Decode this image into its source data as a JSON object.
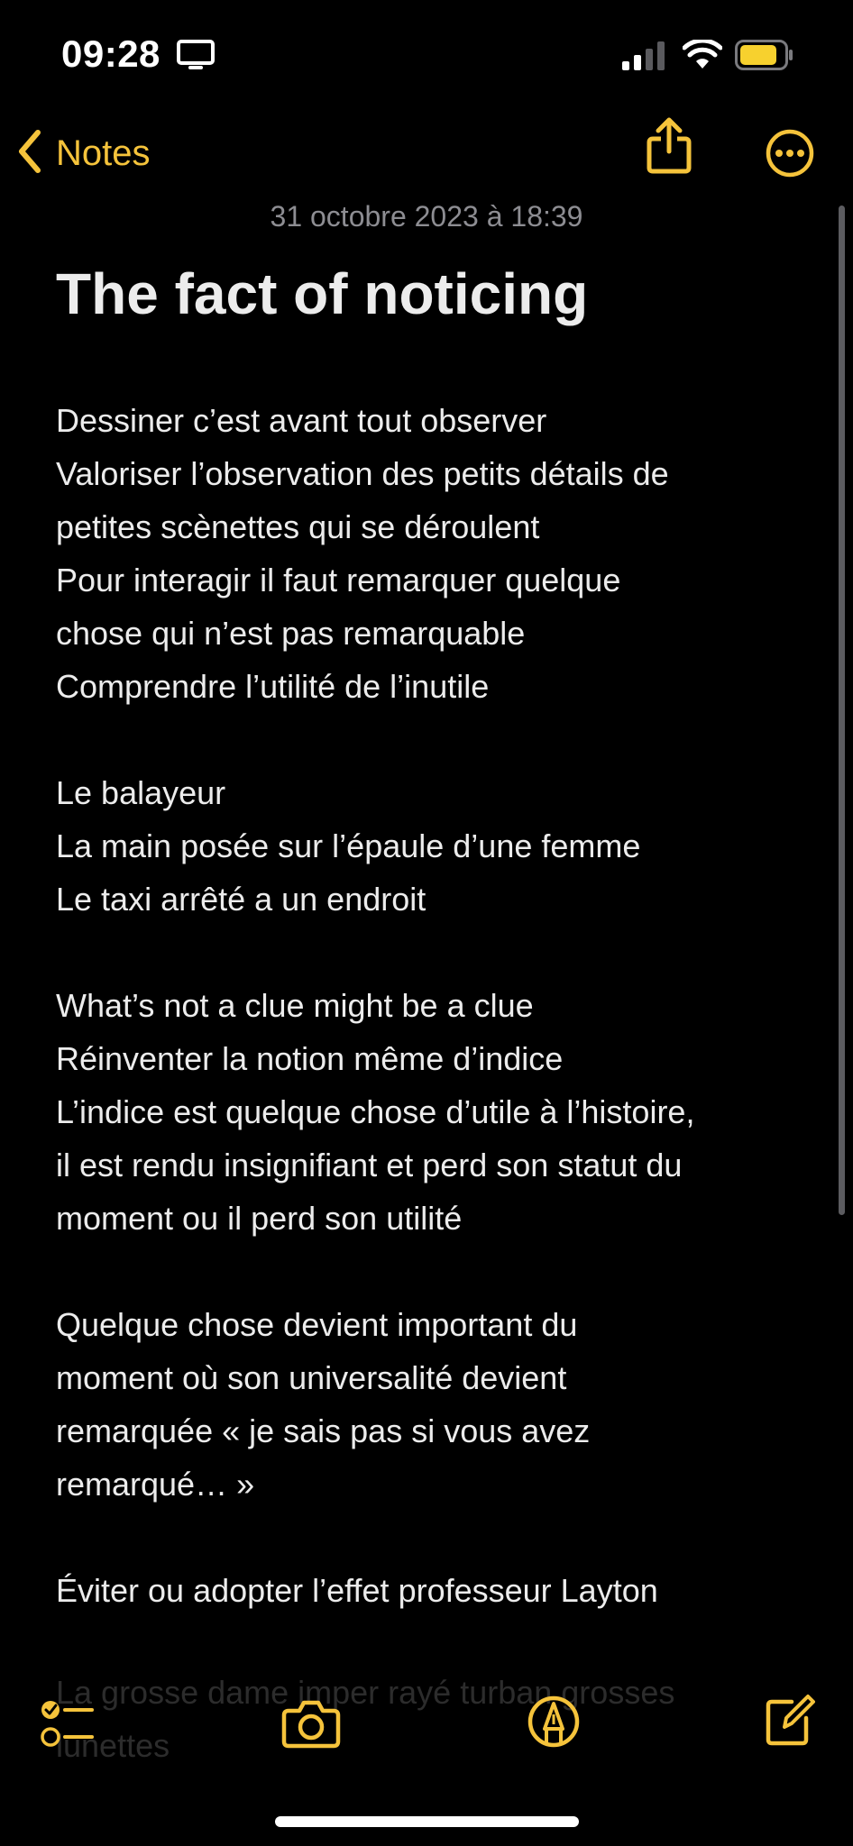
{
  "status_bar": {
    "time": "09:28"
  },
  "nav": {
    "back_label": "Notes"
  },
  "note": {
    "date": "31 octobre 2023 à 18:39",
    "title": "The fact of noticing",
    "lines": [
      "Dessiner c’est avant tout observer",
      "Valoriser l’observation des petits détails de",
      "petites scènettes qui se déroulent",
      "Pour interagir il faut remarquer quelque",
      "chose qui n’est pas remarquable",
      "Comprendre l’utilité de l’inutile",
      "",
      "Le balayeur",
      "La main posée sur l’épaule d’une femme",
      "Le taxi arrêté a un endroit",
      "",
      "What’s not a clue might be a clue",
      "Réinventer la notion même d’indice",
      "L’indice est quelque chose d’utile à l’histoire,",
      "il est rendu insignifiant et perd son statut du",
      "moment ou il perd son utilité",
      "",
      "Quelque chose devient important du",
      "moment où son universalité devient",
      "remarquée « je sais pas si vous avez",
      "remarqué… »",
      "",
      "Éviter ou adopter l’effet professeur Layton"
    ],
    "faded_lines": [
      "La grosse dame imper rayé turban grosses",
      "lunettes"
    ]
  },
  "colors": {
    "accent": "#f5c33b",
    "background": "#000000",
    "text": "#ececec",
    "secondary": "#8d8d92"
  },
  "icons": {
    "back": "chevron-left-icon",
    "share": "share-icon",
    "more": "ellipsis-circle-icon",
    "checklist": "checklist-icon",
    "camera": "camera-icon",
    "markup": "pen-tip-icon",
    "compose": "compose-icon"
  }
}
